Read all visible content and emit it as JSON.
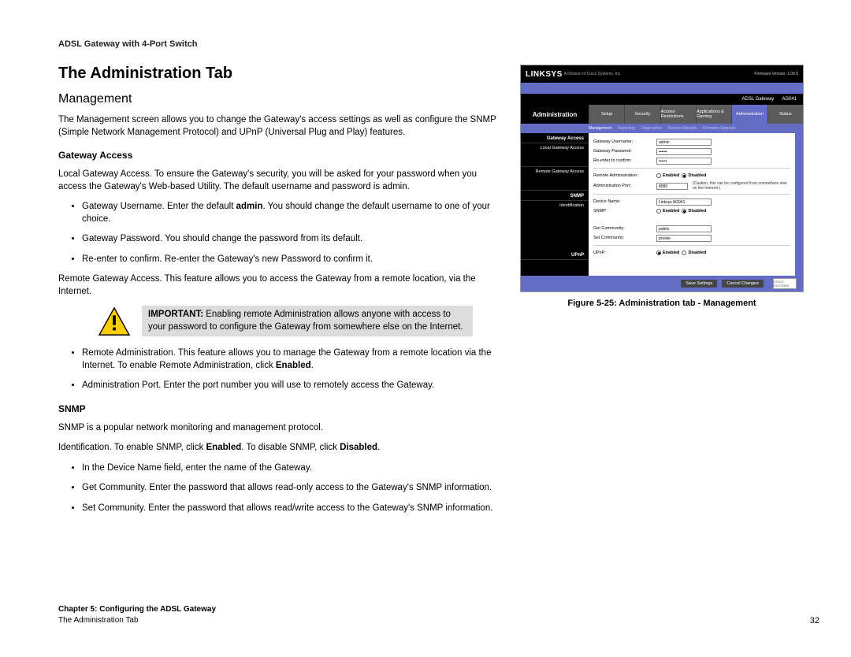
{
  "doc_header": "ADSL Gateway with 4-Port Switch",
  "page_title": "The Administration Tab",
  "section_management": "Management",
  "p_mgmt_intro": "The Management screen allows you to change the Gateway's access settings as well as configure the SNMP (Simple Network Management Protocol) and UPnP (Universal Plug and Play) features.",
  "h_gateway_access": "Gateway Access",
  "p_local_access": "Local Gateway Access. To ensure the Gateway's security, you will be asked for your password when you access the Gateway's Web-based Utility. The default username and password is admin.",
  "li_username_a": "Gateway Username. Enter the default ",
  "li_username_bold": "admin",
  "li_username_b": ". You should change the default username to one of your choice.",
  "li_password": "Gateway Password. You should change the password from its default.",
  "li_reenter": "Re-enter to confirm. Re-enter the Gateway's new Password to confirm it.",
  "p_remote_access": "Remote Gateway Access. This feature allows you to access the Gateway from a remote location, via the Internet.",
  "important_bold": "IMPORTANT:",
  "important_text": " Enabling remote Administration allows anyone with access to your password to configure the Gateway from somewhere else on the Internet.",
  "li_remote_a": "Remote Administration. This feature allows you to manage the Gateway from a remote location via the Internet. To enable Remote Administration, click ",
  "li_remote_bold": "Enabled",
  "li_remote_b": ".",
  "li_admin_port": "Administration Port. Enter the port number you will use to remotely access the Gateway.",
  "h_snmp": "SNMP",
  "p_snmp_intro": "SNMP is a popular network monitoring and management protocol.",
  "p_ident_a": "Identification. To enable SNMP, click ",
  "p_ident_enabled": "Enabled",
  "p_ident_mid": ". To disable SNMP, click ",
  "p_ident_disabled": "Disabled",
  "p_ident_end": ".",
  "li_device_name": "In the Device Name field, enter the name of the Gateway.",
  "li_get_comm": "Get Community. Enter the password that allows read-only access to the Gateway's SNMP information.",
  "li_set_comm": "Set Community. Enter the password that allows read/write access to the Gateway's SNMP information.",
  "fig_caption": "Figure 5-25: Administration tab - Management",
  "footer_chapter": "Chapter 5: Configuring the ADSL Gateway",
  "footer_sub": "The Administration Tab",
  "footer_page": "32",
  "shot": {
    "logo": "LINKSYS",
    "sublogo": "A Division of Cisco Systems, Inc.",
    "fw": "Firmware Version: 1.00.0",
    "model_line": "ADSL Gateway",
    "model_num": "AG041",
    "admin": "Administration",
    "tabs": [
      "Setup",
      "Security",
      "Access Restrictions",
      "Applications & Gaming",
      "Administration",
      "Status"
    ],
    "subtabs": [
      "Management",
      "Reporting",
      "Diagnostics",
      "Factory Defaults",
      "Firmware Upgrade"
    ],
    "side_ga": "Gateway Access",
    "side_lga": "Local Gateway Access",
    "side_rga": "Remote Gateway Access",
    "side_snmp": "SNMP",
    "side_ident": "Identification",
    "side_upnp": "UPnP",
    "lbl_user": "Gateway Username:",
    "val_user": "admin",
    "lbl_pass": "Gateway Password:",
    "lbl_reenter": "Re-enter to confirm:",
    "lbl_remote": "Remote Administration:",
    "lbl_port": "Administration Port:",
    "val_port": "8080",
    "note": "(Caution, this can be configured from somewhere else on the Internet.)",
    "lbl_device": "Device Name:",
    "val_device": "Linksys AG041",
    "lbl_snmp": "SNMP:",
    "lbl_get": "Get Community:",
    "val_get": "public",
    "lbl_set": "Set Community:",
    "val_set": "private",
    "lbl_upnp": "UPnP:",
    "enabled": "Enabled",
    "disabled": "Disabled",
    "btn_save": "Save Settings",
    "btn_cancel": "Cancel Changes",
    "cisco": "CISCO SYSTEMS"
  }
}
